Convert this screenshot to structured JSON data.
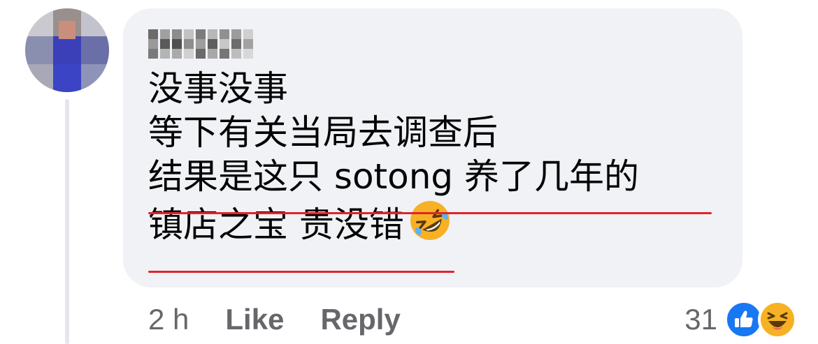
{
  "comment": {
    "lines": [
      "没事没事",
      "等下有关当局去调查后",
      "结果是这只 sotong 养了几年的",
      "镇店之宝 贵没错"
    ],
    "emoji": "rolling-on-the-floor-laughing",
    "annotation_color": "#e0242c"
  },
  "meta": {
    "timestamp": "2 h",
    "like_label": "Like",
    "reply_label": "Reply",
    "reaction_count": "31",
    "reactions": [
      "like",
      "haha"
    ]
  },
  "colors": {
    "bubble": "#f0f2f5",
    "text": "#050505",
    "secondary_text": "#65676b",
    "like_blue": "#1877f2",
    "haha_yellow": "#f7b125"
  }
}
